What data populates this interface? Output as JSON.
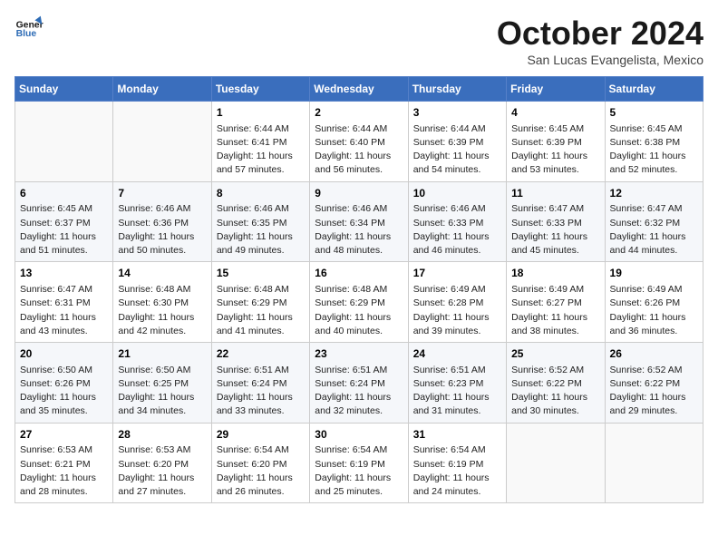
{
  "logo": {
    "line1": "General",
    "line2": "Blue"
  },
  "title": "October 2024",
  "subtitle": "San Lucas Evangelista, Mexico",
  "days_of_week": [
    "Sunday",
    "Monday",
    "Tuesday",
    "Wednesday",
    "Thursday",
    "Friday",
    "Saturday"
  ],
  "weeks": [
    [
      {
        "day": "",
        "info": ""
      },
      {
        "day": "",
        "info": ""
      },
      {
        "day": "1",
        "info": "Sunrise: 6:44 AM\nSunset: 6:41 PM\nDaylight: 11 hours and 57 minutes."
      },
      {
        "day": "2",
        "info": "Sunrise: 6:44 AM\nSunset: 6:40 PM\nDaylight: 11 hours and 56 minutes."
      },
      {
        "day": "3",
        "info": "Sunrise: 6:44 AM\nSunset: 6:39 PM\nDaylight: 11 hours and 54 minutes."
      },
      {
        "day": "4",
        "info": "Sunrise: 6:45 AM\nSunset: 6:39 PM\nDaylight: 11 hours and 53 minutes."
      },
      {
        "day": "5",
        "info": "Sunrise: 6:45 AM\nSunset: 6:38 PM\nDaylight: 11 hours and 52 minutes."
      }
    ],
    [
      {
        "day": "6",
        "info": "Sunrise: 6:45 AM\nSunset: 6:37 PM\nDaylight: 11 hours and 51 minutes."
      },
      {
        "day": "7",
        "info": "Sunrise: 6:46 AM\nSunset: 6:36 PM\nDaylight: 11 hours and 50 minutes."
      },
      {
        "day": "8",
        "info": "Sunrise: 6:46 AM\nSunset: 6:35 PM\nDaylight: 11 hours and 49 minutes."
      },
      {
        "day": "9",
        "info": "Sunrise: 6:46 AM\nSunset: 6:34 PM\nDaylight: 11 hours and 48 minutes."
      },
      {
        "day": "10",
        "info": "Sunrise: 6:46 AM\nSunset: 6:33 PM\nDaylight: 11 hours and 46 minutes."
      },
      {
        "day": "11",
        "info": "Sunrise: 6:47 AM\nSunset: 6:33 PM\nDaylight: 11 hours and 45 minutes."
      },
      {
        "day": "12",
        "info": "Sunrise: 6:47 AM\nSunset: 6:32 PM\nDaylight: 11 hours and 44 minutes."
      }
    ],
    [
      {
        "day": "13",
        "info": "Sunrise: 6:47 AM\nSunset: 6:31 PM\nDaylight: 11 hours and 43 minutes."
      },
      {
        "day": "14",
        "info": "Sunrise: 6:48 AM\nSunset: 6:30 PM\nDaylight: 11 hours and 42 minutes."
      },
      {
        "day": "15",
        "info": "Sunrise: 6:48 AM\nSunset: 6:29 PM\nDaylight: 11 hours and 41 minutes."
      },
      {
        "day": "16",
        "info": "Sunrise: 6:48 AM\nSunset: 6:29 PM\nDaylight: 11 hours and 40 minutes."
      },
      {
        "day": "17",
        "info": "Sunrise: 6:49 AM\nSunset: 6:28 PM\nDaylight: 11 hours and 39 minutes."
      },
      {
        "day": "18",
        "info": "Sunrise: 6:49 AM\nSunset: 6:27 PM\nDaylight: 11 hours and 38 minutes."
      },
      {
        "day": "19",
        "info": "Sunrise: 6:49 AM\nSunset: 6:26 PM\nDaylight: 11 hours and 36 minutes."
      }
    ],
    [
      {
        "day": "20",
        "info": "Sunrise: 6:50 AM\nSunset: 6:26 PM\nDaylight: 11 hours and 35 minutes."
      },
      {
        "day": "21",
        "info": "Sunrise: 6:50 AM\nSunset: 6:25 PM\nDaylight: 11 hours and 34 minutes."
      },
      {
        "day": "22",
        "info": "Sunrise: 6:51 AM\nSunset: 6:24 PM\nDaylight: 11 hours and 33 minutes."
      },
      {
        "day": "23",
        "info": "Sunrise: 6:51 AM\nSunset: 6:24 PM\nDaylight: 11 hours and 32 minutes."
      },
      {
        "day": "24",
        "info": "Sunrise: 6:51 AM\nSunset: 6:23 PM\nDaylight: 11 hours and 31 minutes."
      },
      {
        "day": "25",
        "info": "Sunrise: 6:52 AM\nSunset: 6:22 PM\nDaylight: 11 hours and 30 minutes."
      },
      {
        "day": "26",
        "info": "Sunrise: 6:52 AM\nSunset: 6:22 PM\nDaylight: 11 hours and 29 minutes."
      }
    ],
    [
      {
        "day": "27",
        "info": "Sunrise: 6:53 AM\nSunset: 6:21 PM\nDaylight: 11 hours and 28 minutes."
      },
      {
        "day": "28",
        "info": "Sunrise: 6:53 AM\nSunset: 6:20 PM\nDaylight: 11 hours and 27 minutes."
      },
      {
        "day": "29",
        "info": "Sunrise: 6:54 AM\nSunset: 6:20 PM\nDaylight: 11 hours and 26 minutes."
      },
      {
        "day": "30",
        "info": "Sunrise: 6:54 AM\nSunset: 6:19 PM\nDaylight: 11 hours and 25 minutes."
      },
      {
        "day": "31",
        "info": "Sunrise: 6:54 AM\nSunset: 6:19 PM\nDaylight: 11 hours and 24 minutes."
      },
      {
        "day": "",
        "info": ""
      },
      {
        "day": "",
        "info": ""
      }
    ]
  ]
}
